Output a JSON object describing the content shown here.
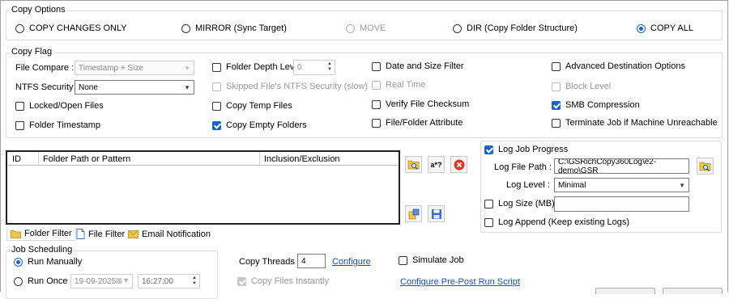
{
  "copy_options": {
    "title": "Copy Options",
    "modes": [
      {
        "label": "COPY CHANGES ONLY",
        "selected": false,
        "enabled": true
      },
      {
        "label": "MIRROR (Sync Target)",
        "selected": false,
        "enabled": true
      },
      {
        "label": "MOVE",
        "selected": false,
        "enabled": false
      },
      {
        "label": "DIR (Copy Folder Structure)",
        "selected": false,
        "enabled": true
      },
      {
        "label": "COPY ALL",
        "selected": true,
        "enabled": true
      }
    ]
  },
  "copy_flag": {
    "title": "Copy Flag",
    "file_compare_label": "File Compare :",
    "file_compare_value": "Timestamp + Size",
    "ntfs_security_label": "NTFS Security :",
    "ntfs_security_value": "None",
    "locked_open_files": "Locked/Open Files",
    "folder_timestamp": "Folder Timestamp",
    "folder_depth_level": "Folder Depth Level",
    "folder_depth_value": "0",
    "skipped_ntfs_security": "Skipped File's NTFS Security (slow)",
    "copy_temp_files": "Copy Temp Files",
    "copy_empty_folders": "Copy Empty Folders",
    "date_size_filter": "Date and Size Filter",
    "real_time": "Real Time",
    "verify_checksum": "Verify File Checksum",
    "file_folder_attribute": "File/Folder Attribute",
    "advanced_destination": "Advanced Destination Options",
    "block_level": "Block Level",
    "smb_compression": "SMB Compression",
    "terminate_job": "Terminate Job if Machine Unreachable"
  },
  "filter_table": {
    "columns": [
      "ID",
      "Folder Path or Pattern",
      "Inclusion/Exclusion"
    ],
    "rows": [],
    "regex_button": "a*?"
  },
  "tabs": [
    "Folder Filter",
    "File Filter",
    "Email Notification"
  ],
  "log": {
    "progress_label": "Log Job Progress",
    "file_path_label": "Log File Path :",
    "file_path_value": "C:\\GSRichCopy360Log\\e2-demo\\GSR",
    "level_label": "Log Level :",
    "level_value": "Minimal",
    "size_label": "Log Size (MB)",
    "size_value": "",
    "append_label": "Log Append (Keep existing Logs)"
  },
  "job_scheduling": {
    "title": "Job Scheduling",
    "run_manually": "Run Manually",
    "run_once": "Run Once",
    "date_value": "19-09-2025",
    "time_value": "16:27:00"
  },
  "threads": {
    "label": "Copy Threads :",
    "value": "4",
    "configure": "Configure"
  },
  "simulate_job": "Simulate Job",
  "copy_files_instantly": "Copy Files Instantly",
  "configure_script": "Configure Pre-Post Run Script",
  "colors": {
    "accent": "#1a64c8",
    "link": "#1a4fb4",
    "delete": "#d93a2b"
  }
}
